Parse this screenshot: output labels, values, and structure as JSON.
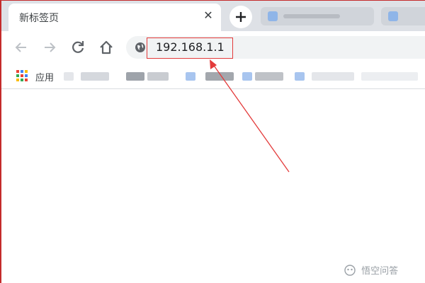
{
  "tabs": {
    "active_title": "新标签页",
    "close_glyph": "✕"
  },
  "omnibox": {
    "url": "192.168.1.1"
  },
  "bookmarks": {
    "apps_label": "应用"
  },
  "annotation": {
    "box_color": "#e33a3a",
    "arrow_color": "#e33a3a"
  },
  "icons": {
    "back": "arrow-left-icon",
    "forward": "arrow-right-icon",
    "reload": "reload-icon",
    "home": "home-icon",
    "globe": "globe-icon",
    "apps": "apps-grid-icon",
    "new_tab": "plus-icon"
  },
  "watermark": {
    "text": "悟空问答"
  }
}
